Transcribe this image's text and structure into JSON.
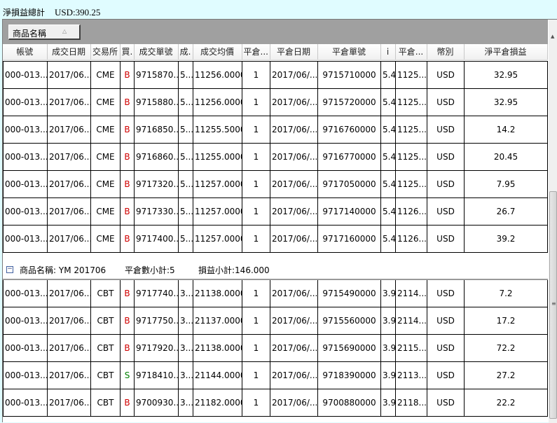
{
  "summary": {
    "label": "淨損益總計",
    "total": "USD:390.25"
  },
  "group_by_button": {
    "label": "商品名稱",
    "sort": "ascending"
  },
  "columns": [
    "帳號",
    "成交日期",
    "交易所",
    "買.",
    "成交單號",
    "成.",
    "成交均價",
    "平倉...",
    "平倉日期",
    "平倉單號",
    "i",
    "平倉...",
    "幣別",
    "淨平倉損益"
  ],
  "groups": [
    {
      "rows": [
        [
          "000-013...",
          "2017/06...",
          "CME",
          "B",
          "9715870...",
          "5...",
          "11256.0000",
          "1",
          "2017/06/...",
          "9715710000",
          "5.4",
          "1125...",
          "USD",
          "32.95"
        ],
        [
          "000-013...",
          "2017/06...",
          "CME",
          "B",
          "9715880...",
          "5...",
          "11256.0000",
          "1",
          "2017/06/...",
          "9715720000",
          "5.4",
          "1125...",
          "USD",
          "32.95"
        ],
        [
          "000-013...",
          "2017/06...",
          "CME",
          "B",
          "9716850...",
          "5...",
          "11255.5000",
          "1",
          "2017/06/...",
          "9716760000",
          "5.4",
          "1125...",
          "USD",
          "14.2"
        ],
        [
          "000-013...",
          "2017/06...",
          "CME",
          "B",
          "9716860...",
          "5...",
          "11255.0000",
          "1",
          "2017/06/...",
          "9716770000",
          "5.4",
          "1125...",
          "USD",
          "20.45"
        ],
        [
          "000-013...",
          "2017/06...",
          "CME",
          "B",
          "9717320...",
          "5...",
          "11257.0000",
          "1",
          "2017/06/...",
          "9717050000",
          "5.4",
          "1125...",
          "USD",
          "7.95"
        ],
        [
          "000-013...",
          "2017/06...",
          "CME",
          "B",
          "9717330...",
          "5...",
          "11257.0000",
          "1",
          "2017/06/...",
          "9717140000",
          "5.4",
          "1126...",
          "USD",
          "26.7"
        ],
        [
          "000-013...",
          "2017/06...",
          "CME",
          "B",
          "9717400...",
          "5...",
          "11257.0000",
          "1",
          "2017/06/...",
          "9717160000",
          "5.4",
          "1126...",
          "USD",
          "39.2"
        ]
      ]
    },
    {
      "header": {
        "product": "商品名稱: YM 201706",
        "count": "平倉數小計:5",
        "pnl": "損益小計:146.000"
      },
      "rows": [
        [
          "000-013...",
          "2017/06...",
          "CBT",
          "B",
          "9717740...",
          "3...",
          "21138.0000",
          "1",
          "2017/06/...",
          "9715490000",
          "3.9",
          "2114...",
          "USD",
          "7.2"
        ],
        [
          "000-013...",
          "2017/06...",
          "CBT",
          "B",
          "9717750...",
          "3...",
          "21137.0000",
          "1",
          "2017/06/...",
          "9715560000",
          "3.9",
          "2114...",
          "USD",
          "17.2"
        ],
        [
          "000-013...",
          "2017/06...",
          "CBT",
          "B",
          "9717920...",
          "3...",
          "21138.0000",
          "1",
          "2017/06/...",
          "9715690000",
          "3.9",
          "2115...",
          "USD",
          "72.2"
        ],
        [
          "000-013...",
          "2017/06...",
          "CBT",
          "S",
          "9718410...",
          "3...",
          "21144.0000",
          "1",
          "2017/06/...",
          "9718390000",
          "3.9",
          "2113...",
          "USD",
          "27.2"
        ],
        [
          "000-013...",
          "2017/06...",
          "CBT",
          "B",
          "9700930...",
          "3...",
          "21182.0000",
          "1",
          "2017/06/...",
          "9700880000",
          "3.9",
          "2118...",
          "USD",
          "22.2"
        ]
      ]
    }
  ],
  "colors": {
    "buy": "#d00000",
    "sell": "#008000",
    "background": "#e0fcff",
    "group_bar": "#a0a0a0"
  }
}
